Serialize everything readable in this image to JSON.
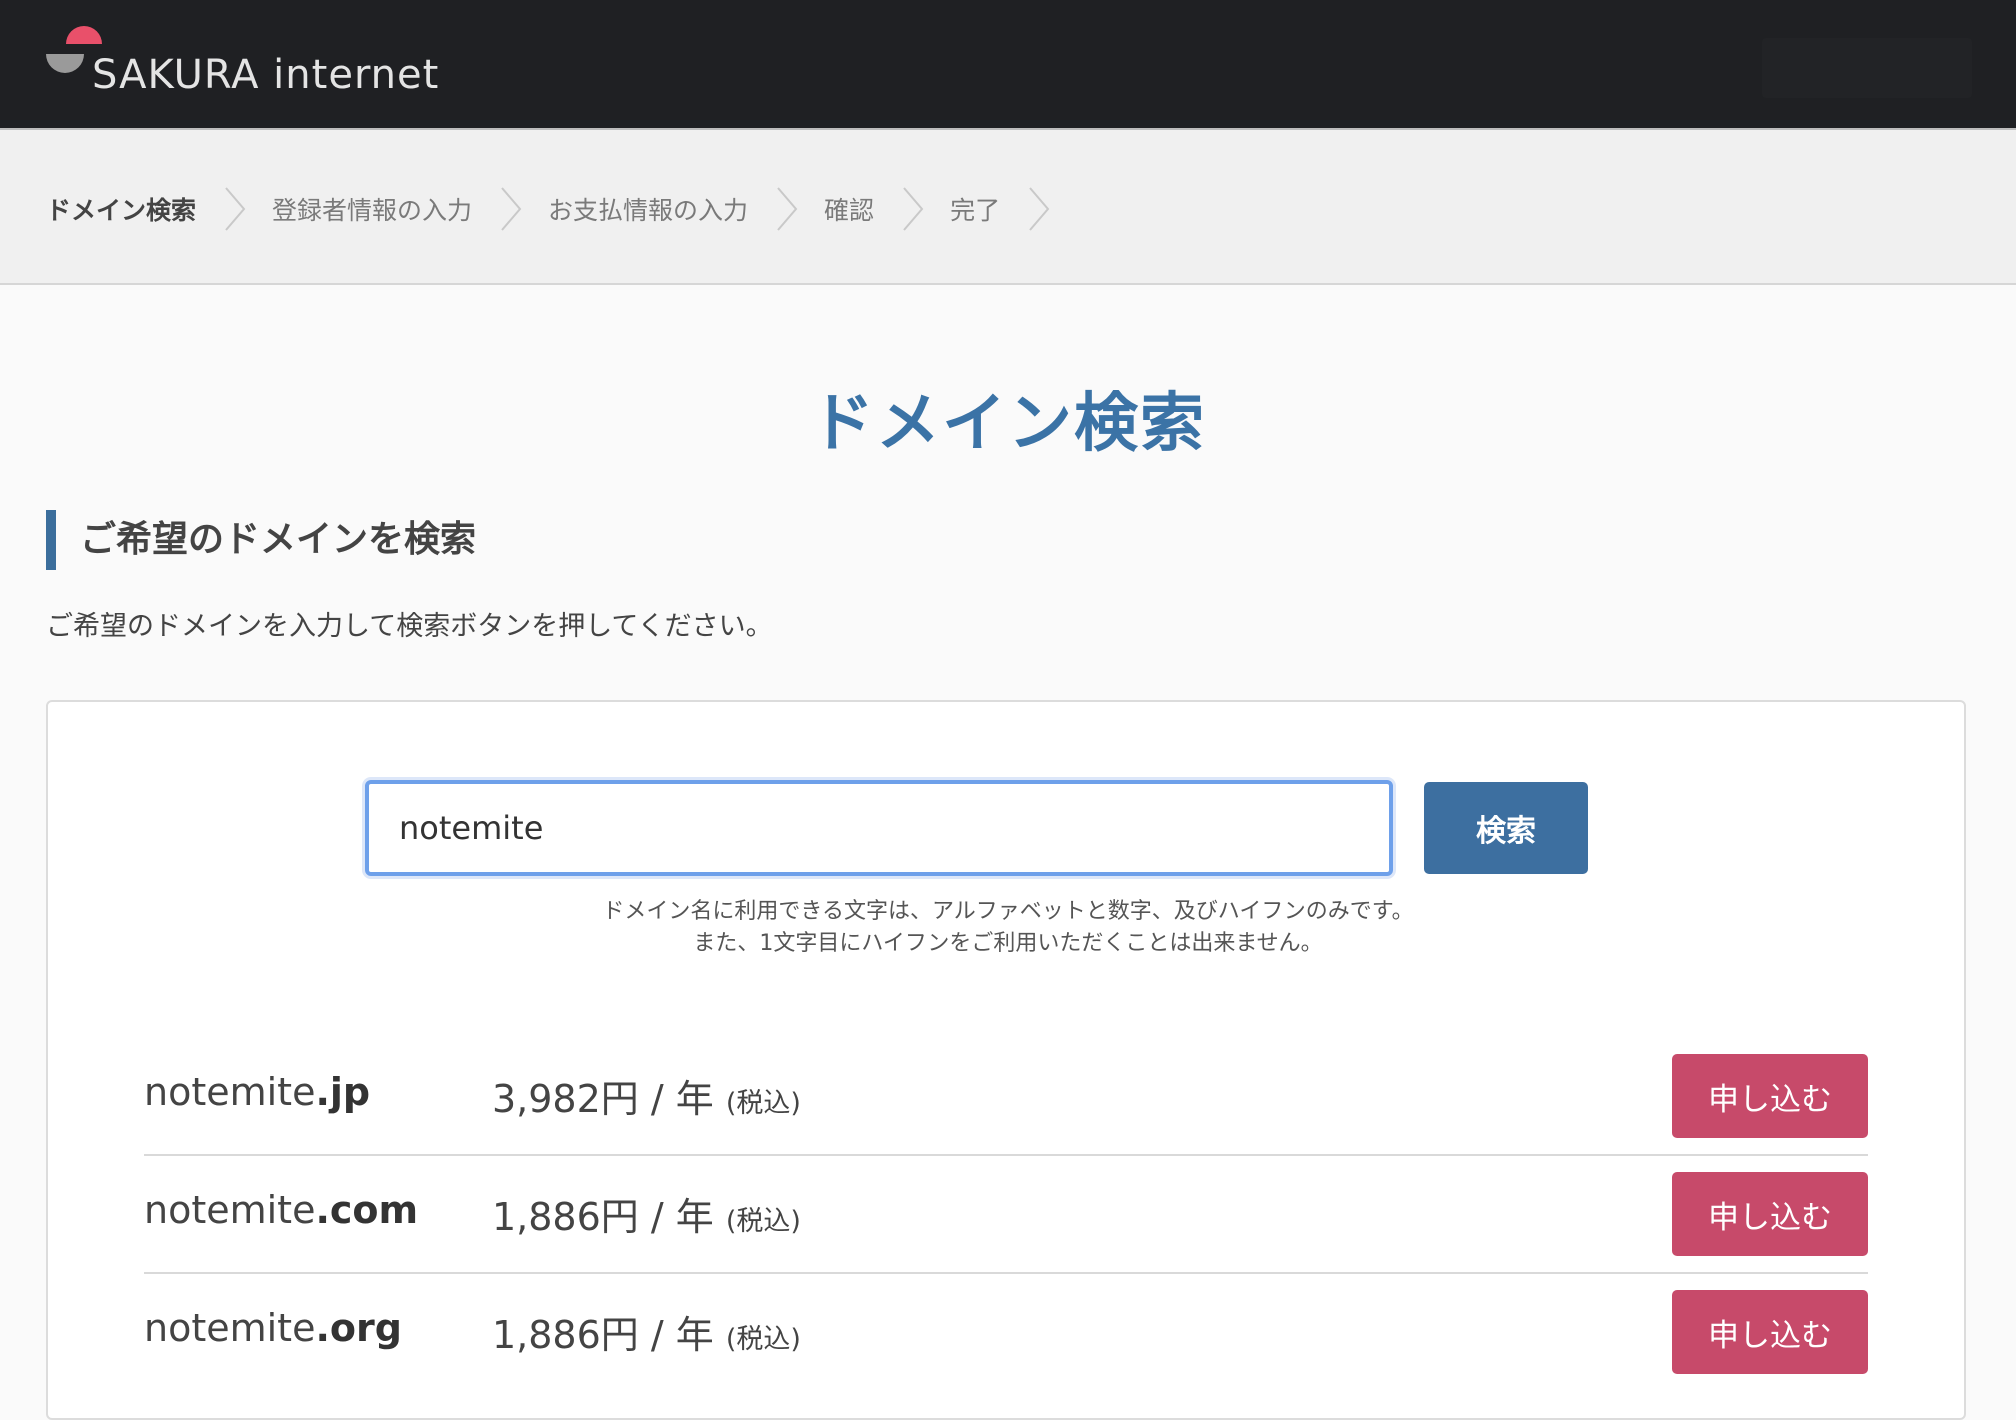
{
  "header": {
    "logo_text": "SAKURA internet",
    "logo_icon": "sakura-logo-icon",
    "brand_color": "#e9506a"
  },
  "steps": [
    {
      "label": "ドメイン検索",
      "active": true
    },
    {
      "label": "登録者情報の入力",
      "active": false
    },
    {
      "label": "お支払情報の入力",
      "active": false
    },
    {
      "label": "確認",
      "active": false
    },
    {
      "label": "完了",
      "active": false
    }
  ],
  "main": {
    "title": "ドメイン検索",
    "section_heading": "ご希望のドメインを検索",
    "section_desc": "ご希望のドメインを入力して検索ボタンを押してください。"
  },
  "search": {
    "value": "notemite",
    "button_label": "検索",
    "hint_line1": "ドメイン名に利用できる文字は、アルファベットと数字、及びハイフンのみです。",
    "hint_line2": "また、1文字目にハイフンをご利用いただくことは出来ません。"
  },
  "results": [
    {
      "name": "notemite",
      "tld": ".jp",
      "price": "3,982円 / 年",
      "tax": "(税込)",
      "button": "申し込む"
    },
    {
      "name": "notemite",
      "tld": ".com",
      "price": "1,886円 / 年",
      "tax": "(税込)",
      "button": "申し込む"
    },
    {
      "name": "notemite",
      "tld": ".org",
      "price": "1,886円 / 年",
      "tax": "(税込)",
      "button": "申し込む"
    }
  ],
  "colors": {
    "accent_blue": "#3b73a6",
    "apply_button": "#c74a6a",
    "header_bg": "#1f2023"
  }
}
